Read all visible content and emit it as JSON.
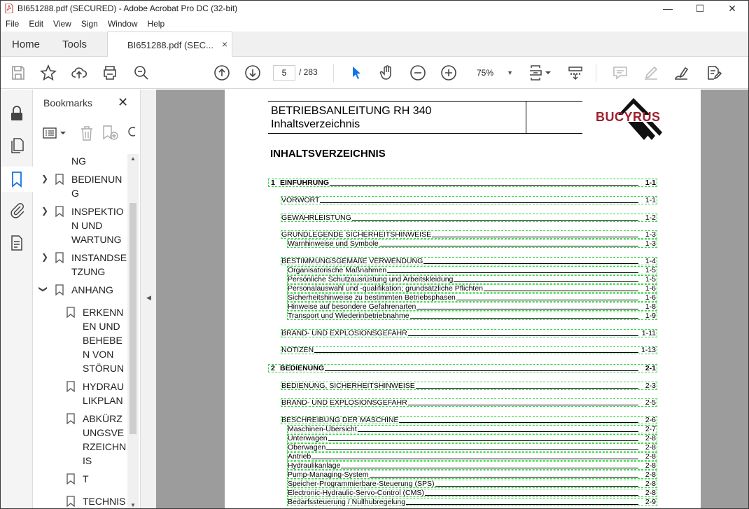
{
  "window": {
    "title": "BI651288.pdf (SECURED) - Adobe Acrobat Pro DC (32-bit)",
    "min": "—",
    "max": "☐",
    "close": "✕"
  },
  "menu": [
    "File",
    "Edit",
    "View",
    "Sign",
    "Window",
    "Help"
  ],
  "tabs": {
    "home": "Home",
    "tools": "Tools",
    "doc": "BI651288.pdf (SEC...",
    "doc_close": "×"
  },
  "toolbar": {
    "page_current": "5",
    "page_total": "/ 283",
    "zoom": "75%"
  },
  "bookmarks": {
    "title": "Bookmarks",
    "close": "✕",
    "items": [
      {
        "label": "NG",
        "indent": 0,
        "expander": "none"
      },
      {
        "label": "BEDIENUN\nG",
        "indent": 0,
        "expander": "collapsed"
      },
      {
        "label": "INSPEKTIO\nN UND\nWARTUNG",
        "indent": 0,
        "expander": "collapsed"
      },
      {
        "label": "INSTANDSE\nTZUNG",
        "indent": 0,
        "expander": "collapsed"
      },
      {
        "label": "ANHANG",
        "indent": 0,
        "expander": "expanded"
      },
      {
        "label": "ERKENN\nEN UND\nBEHEBE\nN VON\nSTÖRUN",
        "indent": 1,
        "expander": "none"
      },
      {
        "label": "HYDRAU\nLIKPLAN",
        "indent": 1,
        "expander": "none"
      },
      {
        "label": "ABKÜRZ\nUNGSVE\nRZEICHN\nIS",
        "indent": 1,
        "expander": "none"
      },
      {
        "label": "T",
        "indent": 1,
        "expander": "none"
      },
      {
        "label": "TECHNIS",
        "indent": 1,
        "expander": "none"
      }
    ]
  },
  "document": {
    "header_line1": "BETRIEBSANLEITUNG RH 340",
    "header_line2": "Inhaltsverzeichnis",
    "brand": "BUCYRUS",
    "toc_title": "INHALTSVERZEICHNIS",
    "toc": [
      {
        "num": "1",
        "text": "EINFÜHRUNG",
        "page": "1-1",
        "level": 0
      },
      {
        "text": "VORWORT",
        "page": "1-1",
        "level": 1
      },
      {
        "text": "GEWÄHRLEISTUNG",
        "page": "1-2",
        "level": 1
      },
      {
        "text": "GRUNDLEGENDE SICHERHEITSHINWEISE",
        "page": "1-3",
        "level": 1
      },
      {
        "text": "Warnhinweise und Symbole",
        "page": "1-3",
        "level": 2
      },
      {
        "text": "BESTIMMUNGSGEMÄßE VERWENDUNG",
        "page": "1-4",
        "level": 1
      },
      {
        "text": "Organisatorische Maßnahmen",
        "page": "1-5",
        "level": 2
      },
      {
        "text": "Persönliche Schutzausrüstung und Arbeitskleidung",
        "page": "1-5",
        "level": 2
      },
      {
        "text": "Personalauswahl und -qualifikation; grundsätzliche Pflichten",
        "page": "1-6",
        "level": 2
      },
      {
        "text": "Sicherheitshinweise zu bestimmten Betriebsphasen",
        "page": "1-6",
        "level": 2
      },
      {
        "text": "Hinweise auf besondere Gefahrenarten",
        "page": "1-8",
        "level": 2
      },
      {
        "text": "Transport und Wiederinbetriebnahme",
        "page": "1-9",
        "level": 2
      },
      {
        "text": "BRAND- UND EXPLOSIONSGEFAHR",
        "page": "1-11",
        "level": 1
      },
      {
        "text": "NOTIZEN",
        "page": "1-13",
        "level": 1
      },
      {
        "num": "2",
        "text": "BEDIENUNG",
        "page": "2-1",
        "level": 0
      },
      {
        "text": "BEDIENUNG, SICHERHEITSHINWEISE",
        "page": "2-3",
        "level": 1
      },
      {
        "text": "BRAND- UND EXPLOSIONSGEFAHR",
        "page": "2-5",
        "level": 1
      },
      {
        "text": "BESCHREIBUNG DER MASCHINE",
        "page": "2-6",
        "level": 1
      },
      {
        "text": "Maschinen-Übersicht",
        "page": "2-7",
        "level": 2
      },
      {
        "text": "Unterwagen",
        "page": "2-8",
        "level": 2
      },
      {
        "text": "Oberwagen",
        "page": "2-8",
        "level": 2
      },
      {
        "text": "Antrieb",
        "page": "2-8",
        "level": 2
      },
      {
        "text": "Hydraulikanlage",
        "page": "2-8",
        "level": 2
      },
      {
        "text": "Pump-Managing-System",
        "page": "2-8",
        "level": 2
      },
      {
        "text": "Speicher-Programmierbare-Steuerung (SPS)",
        "page": "2-8",
        "level": 2
      },
      {
        "text": "Electronic-Hydraulic-Servo-Control (CMS)",
        "page": "2-8",
        "level": 2
      },
      {
        "text": "Bedarfssteuerung / Nullhubregelung",
        "page": "2-9",
        "level": 2
      }
    ]
  }
}
